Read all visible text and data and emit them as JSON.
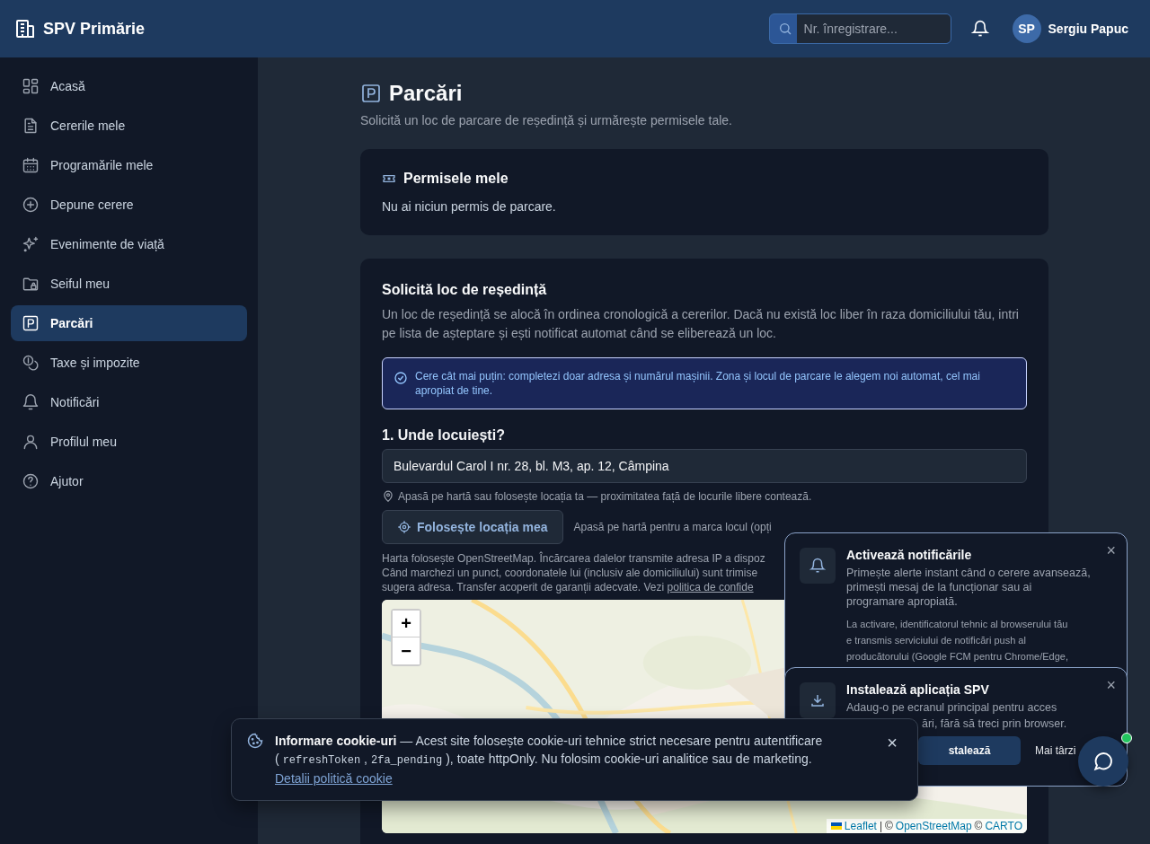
{
  "header": {
    "brand": "SPV Primărie",
    "search": {
      "placeholder": "Nr. înregistrare..."
    },
    "user": {
      "initials": "SP",
      "name": "Sergiu Papuc"
    }
  },
  "sidebar": {
    "items": [
      {
        "label": "Acasă",
        "selected": false
      },
      {
        "label": "Cererile mele",
        "selected": false
      },
      {
        "label": "Programările mele",
        "selected": false
      },
      {
        "label": "Depune cerere",
        "selected": false
      },
      {
        "label": "Evenimente de viață",
        "selected": false
      },
      {
        "label": "Seiful meu",
        "selected": false
      },
      {
        "label": "Parcări",
        "selected": true
      },
      {
        "label": "Taxe și impozite",
        "selected": false
      },
      {
        "label": "Notificări",
        "selected": false
      },
      {
        "label": "Profilul meu",
        "selected": false
      },
      {
        "label": "Ajutor",
        "selected": false
      }
    ]
  },
  "page": {
    "title": "Parcări",
    "subtitle": "Solicită un loc de parcare de reședință și urmărește permisele tale."
  },
  "permits": {
    "title": "Permisele mele",
    "empty": "Nu ai niciun permis de parcare."
  },
  "request": {
    "title": "Solicită loc de reședință",
    "intro": "Un loc de reședință se alocă în ordinea cronologică a cererilor. Dacă nu există loc liber în raza domiciliului tău, intri pe lista de așteptare și ești notificat automat când se eliberează un loc.",
    "info": "Cere cât mai puțin: completezi doar adresa și numărul mașinii. Zona și locul de parcare le alegem noi automat, cel mai apropiat de tine.",
    "step": "1. Unde locuiești?",
    "address": "Bulevardul Carol I nr. 28, bl. M3, ap. 12, Câmpina",
    "hint": "Apasă pe hartă sau folosește locația ta — proximitatea față de locurile libere contează.",
    "locate_button": "Folosește locația mea",
    "locate_hint": "Apasă pe hartă pentru a marca locul (opți",
    "privacy_lines": [
      "Harta folosește OpenStreetMap. Încărcarea dalelor transmite adresa IP a dispoz",
      "Când marchezi un punct, coordonatele lui (inclusiv ale domiciliului) sunt trimise"
    ],
    "privacy_last": "sugera adresa. Transfer acoperit de garanții adecvate. Vezi",
    "privacy_link": "politica de confide",
    "map": {
      "zoom_in": "+",
      "zoom_out": "−",
      "attribution": [
        {
          "text": "Leaflet",
          "kind": "link"
        },
        {
          "text": "|",
          "kind": "text"
        },
        {
          "text": "©",
          "kind": "text"
        },
        {
          "text": "OpenStreetMap",
          "kind": "link"
        },
        {
          "text": "©",
          "kind": "text"
        },
        {
          "text": "CARTO",
          "kind": "link"
        }
      ]
    }
  },
  "notify_card": {
    "title": "Activează notificările",
    "body": "Primește alerte instant când o cerere avansează, primești mesaj de la funcționar sau ai programare apropiată.",
    "detail_lines": [
      "La activare, identificatorul tehnic al browserului tău",
      "e transmis serviciului de notificări push al",
      "producătorului (Google FCM pentru Chrome/Edge,"
    ],
    "close": "×"
  },
  "install_card": {
    "title": "Instalează aplicația SPV",
    "line1": "Adaug-o pe ecranul principal pentru acces",
    "line2": "ări, fără să treci prin browser.",
    "install_button": "stalează",
    "later_button": "Mai târzi",
    "close": "×"
  },
  "cookie": {
    "title": "Informare cookie-uri",
    "text1": "— Acest site folosește cookie-uri tehnice strict necesare pentru autentificare (",
    "codes": [
      "refreshToken",
      "2fa_pending"
    ],
    "code_separator": ",",
    "text2": "), toate httpOnly. Nu folosim cookie-uri analitice sau de marketing.",
    "link": "Detalii politică cookie",
    "close": "×"
  },
  "chat": {
    "online": true
  }
}
